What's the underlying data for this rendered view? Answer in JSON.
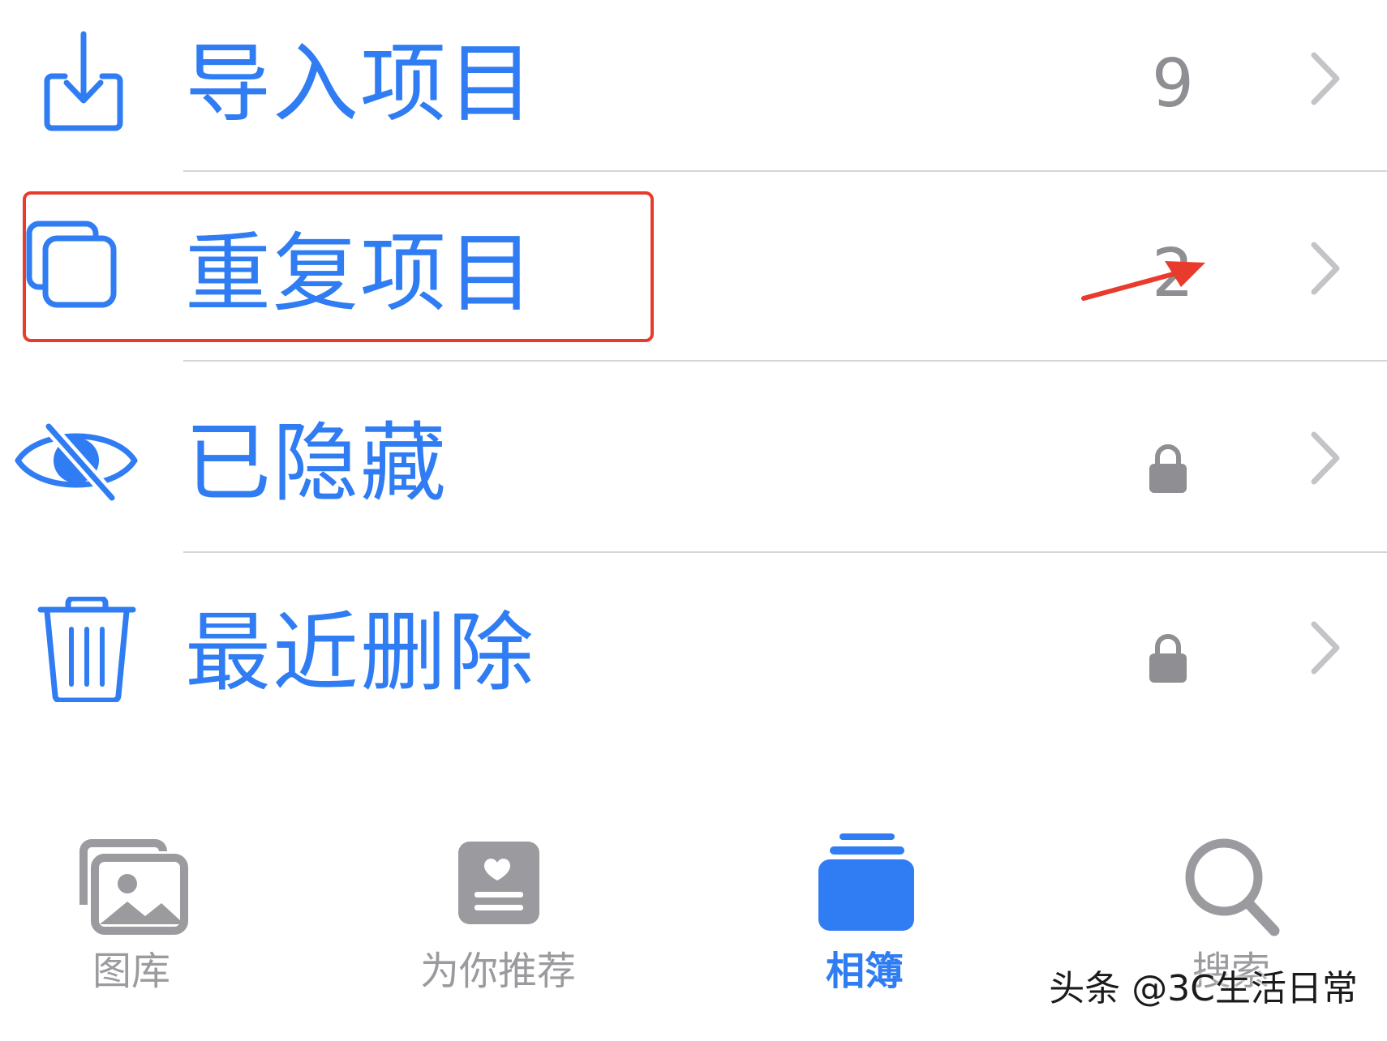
{
  "colors": {
    "accent": "#2f7cf3",
    "secondary": "#8e8e93",
    "separator": "#d5d5da",
    "annotation": "#e83b2c",
    "tab_inactive": "#9b9b9f"
  },
  "list": {
    "items": [
      {
        "label": "导入项目",
        "count": "9",
        "icon": "import-icon",
        "accessory": "count"
      },
      {
        "label": "重复项目",
        "count": "2",
        "icon": "duplicate-icon",
        "accessory": "count"
      },
      {
        "label": "已隐藏",
        "count": "",
        "icon": "eye-slash-icon",
        "accessory": "lock-icon"
      },
      {
        "label": "最近删除",
        "count": "",
        "icon": "trash-icon",
        "accessory": "lock-icon"
      }
    ]
  },
  "tabbar": {
    "tabs": [
      {
        "label": "图库",
        "icon": "photos-icon",
        "active": false
      },
      {
        "label": "为你推荐",
        "icon": "for-you-icon",
        "active": false
      },
      {
        "label": "相簿",
        "icon": "albums-icon",
        "active": true
      },
      {
        "label": "搜索",
        "icon": "search-icon",
        "active": false
      }
    ]
  },
  "watermark": {
    "text": "头条 @3C生活日常"
  }
}
